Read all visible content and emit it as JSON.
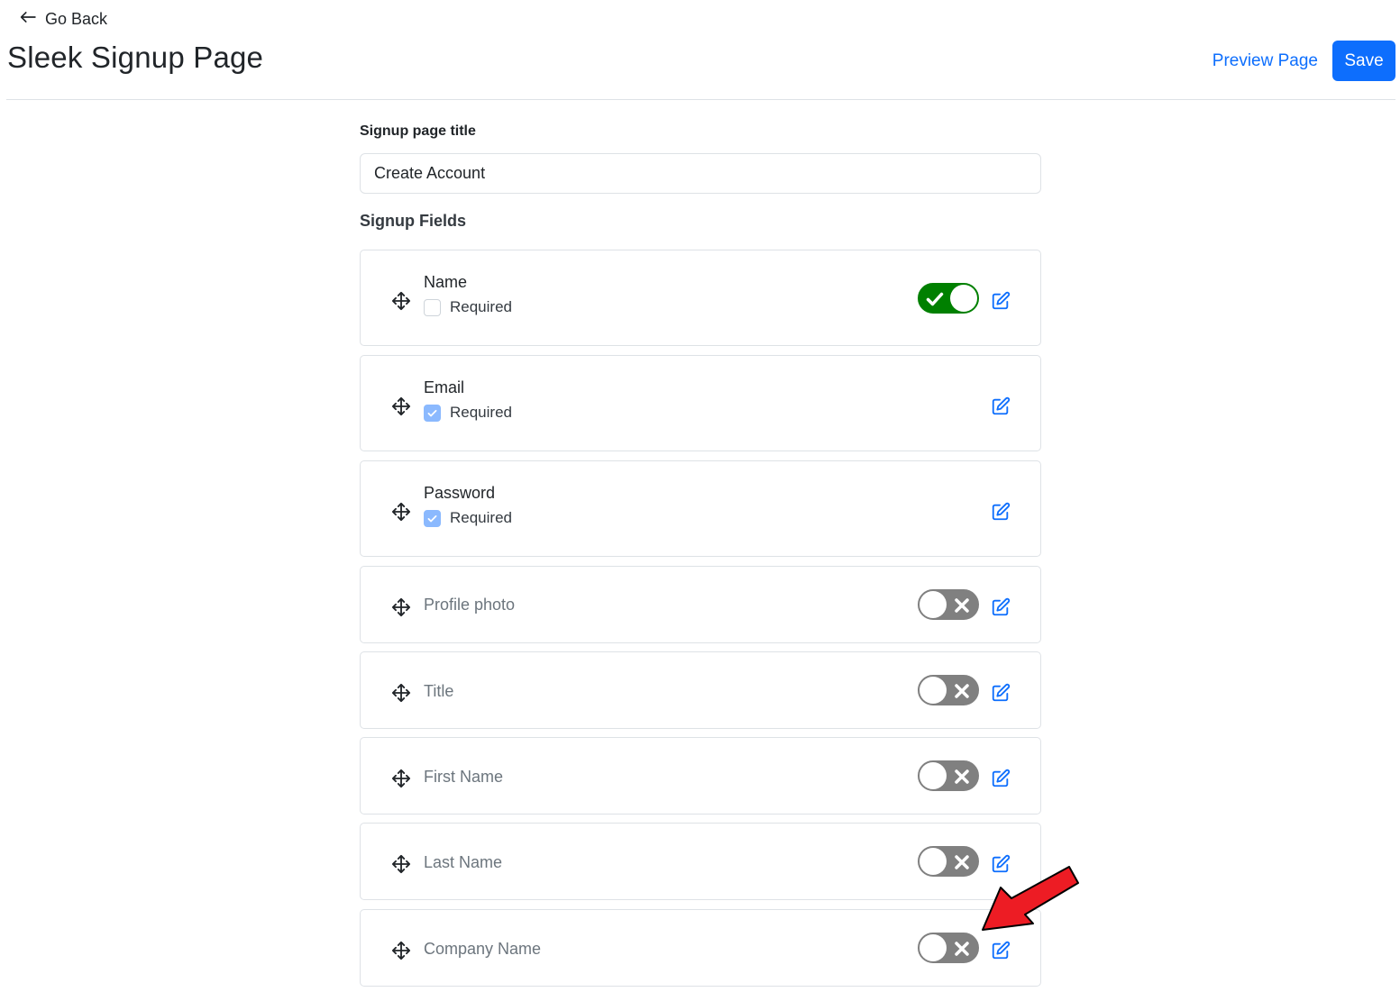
{
  "header": {
    "back_label": "Go Back",
    "title": "Sleek Signup Page",
    "preview_label": "Preview Page",
    "save_label": "Save"
  },
  "form": {
    "title_label": "Signup page title",
    "title_value": "Create Account",
    "fields_heading": "Signup Fields"
  },
  "fields": [
    {
      "name": "Name",
      "required_label": "Required",
      "required": false,
      "toggle": "on"
    },
    {
      "name": "Email",
      "required_label": "Required",
      "required": true
    },
    {
      "name": "Password",
      "required_label": "Required",
      "required": true
    },
    {
      "name": "Profile photo",
      "toggle": "off"
    },
    {
      "name": "Title",
      "toggle": "off"
    },
    {
      "name": "First Name",
      "toggle": "off"
    },
    {
      "name": "Last Name",
      "toggle": "off"
    },
    {
      "name": "Company Name",
      "toggle": "off"
    }
  ],
  "colors": {
    "primary": "#0d6efd",
    "toggle_on": "#008000",
    "toggle_off": "#808080",
    "checkbox_checked": "#8bb9fe",
    "annotation_arrow": "#ed1c24"
  },
  "icons": {
    "back": "arrow-left-icon",
    "drag": "move-arrows-icon",
    "edit": "pencil-square-icon",
    "toggle_on": "check-icon",
    "toggle_off": "x-icon"
  }
}
